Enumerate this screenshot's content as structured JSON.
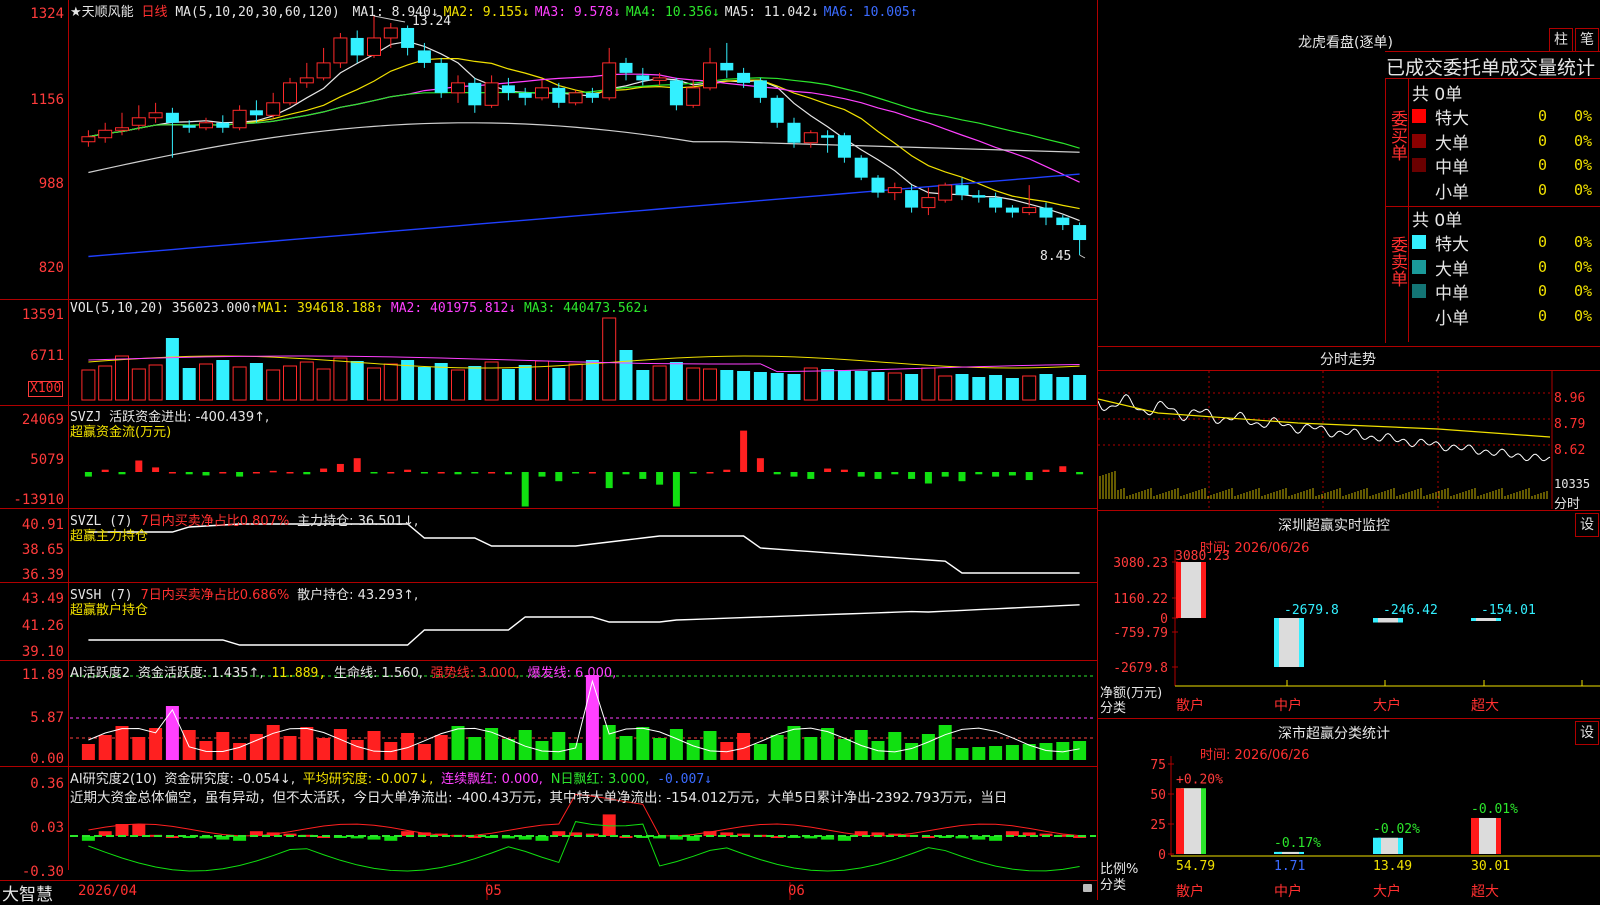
{
  "stock": {
    "name": "★天顺风能",
    "period": "日线",
    "ma_params": "MA(5,10,20,30,60,120)",
    "ma_values": [
      {
        "label": "MA1:",
        "value": "8.940↓",
        "color": "#e6e6e6"
      },
      {
        "label": "MA2:",
        "value": "9.155↓",
        "color": "#f0e000"
      },
      {
        "label": "MA3:",
        "value": "9.578↓",
        "color": "#ff40ff"
      },
      {
        "label": "MA4:",
        "value": "10.356↓",
        "color": "#2ce62c"
      },
      {
        "label": "MA5:",
        "value": "11.042↓",
        "color": "#e6e6e6"
      },
      {
        "label": "MA6:",
        "value": "10.005↑",
        "color": "#3b6bff"
      }
    ],
    "price_axis": [
      "1324",
      "1156",
      "988",
      "820"
    ],
    "high_marker": "13.24",
    "low_marker": "8.45"
  },
  "vol": {
    "legend_name": "VOL(5,10,20)",
    "legend_value": "356023.000↑",
    "ma1": "MA1: 394618.188↑",
    "ma2": "MA2: 401975.812↓",
    "ma3": "MA3: 440473.562↓",
    "axis": [
      "13591",
      "6711"
    ],
    "unit": "X100"
  },
  "svzj": {
    "legend_name": "SVZJ",
    "legend_text": "活跃资金进出: -400.439↑,",
    "subtitle": "超赢资金流(万元)",
    "axis": [
      "24069",
      "5079",
      "-13910"
    ]
  },
  "svzl": {
    "legend_name": "SVZL (7)",
    "legend_text1": "7日内买卖净占比0.807%",
    "legend_text2": "主力持仓: 36.501↓,",
    "subtitle": "超赢主力持仓",
    "axis": [
      "40.91",
      "38.65",
      "36.39"
    ]
  },
  "svsh": {
    "legend_name": "SVSH (7)",
    "legend_text1": "7日内买卖净占比0.686%",
    "legend_text2": "散户持仓: 43.293↑,",
    "subtitle": "超赢散户持仓",
    "axis": [
      "43.49",
      "41.26",
      "39.10"
    ]
  },
  "ai1": {
    "legend_name": "AI活跃度2",
    "legend_text1": "资金活跃度: 1.435↑,",
    "legend_text2": "11.889,",
    "legend_text3": "生命线: 1.560,",
    "legend_text4": "强势线: 3.000,",
    "legend_text5": "爆发线: 6.000,",
    "axis": [
      "11.89",
      "5.87",
      "0.00"
    ]
  },
  "ai2": {
    "legend_name": "AI研究度2(10)",
    "legend_text1": "资金研究度: -0.054↓,",
    "legend_text2": "平均研究度: -0.007↓,",
    "legend_text3": "连续飘红: 0.000,",
    "legend_text4": "N日飘红: 3.000,",
    "legend_text5": "-0.007↓",
    "comment": "近期大资金总体偏空，虽有异动，但不太活跃，今日大单净流出: -400.43万元，其中特大单净流出: -154.012万元，大单5日累计净出-2392.793万元，当日",
    "axis": [
      "0.36",
      "0.03",
      "-0.30"
    ]
  },
  "dates": {
    "d1": "2026/04",
    "d2": "05",
    "d3": "06"
  },
  "brand": "大智慧",
  "right": {
    "lhb_title": "龙虎看盘(逐单)",
    "btn_zhu": "柱",
    "btn_bi": "笔",
    "tabs": "已成交委托单成交量统计",
    "buy_label": "委买单",
    "sell_label": "委卖单",
    "buy_total": "共 0单",
    "sell_total": "共 0单",
    "buy_rows": [
      {
        "name": "特大",
        "count": "0",
        "pct": "0%",
        "color": "#ff0000"
      },
      {
        "name": "大单",
        "count": "0",
        "pct": "0%",
        "color": "#8b0000"
      },
      {
        "name": "中单",
        "count": "0",
        "pct": "0%",
        "color": "#6a0000"
      },
      {
        "name": "小单",
        "count": "0",
        "pct": "0%",
        "color": "#000000"
      }
    ],
    "sell_rows": [
      {
        "name": "特大",
        "count": "0",
        "pct": "0%",
        "color": "#33f0ff"
      },
      {
        "name": "大单",
        "count": "0",
        "pct": "0%",
        "color": "#1a9a9a"
      },
      {
        "name": "中单",
        "count": "0",
        "pct": "0%",
        "color": "#137575"
      },
      {
        "name": "小单",
        "count": "0",
        "pct": "0%",
        "color": "#000000"
      }
    ],
    "fenshi_title": "分时走势",
    "fenshi_axis": [
      "8.96",
      "8.79",
      "8.62"
    ],
    "fenshi_vol": "10335",
    "fenshi_label": "分时",
    "sz_title": "深圳超赢实时监控",
    "sz_btn": "设",
    "sz_time": "时间: 2026/06/26",
    "sz_axis": [
      "3080.23",
      "1160.22",
      "0",
      "-759.79",
      "-2679.8"
    ],
    "sz_ylabel1": "净额(万元)",
    "sz_ylabel2": "分类",
    "sz_bars": [
      {
        "cat": "散户",
        "value": 3080.23,
        "label": "3080.23"
      },
      {
        "cat": "中户",
        "value": -2679.8,
        "label": "-2679.8"
      },
      {
        "cat": "大户",
        "value": -246.42,
        "label": "-246.42"
      },
      {
        "cat": "超大",
        "value": -154.01,
        "label": "-154.01"
      }
    ],
    "cls_title": "深市超赢分类统计",
    "cls_btn": "设",
    "cls_time": "时间: 2026/06/26",
    "cls_axis": [
      "75",
      "50",
      "25",
      "0"
    ],
    "cls_ylabel1": "比例%",
    "cls_ylabel2": "分类",
    "cls_bars": [
      {
        "cat": "散户",
        "value": 54.79,
        "label": "54.79",
        "chg": "+0.20%"
      },
      {
        "cat": "中户",
        "value": 1.71,
        "label": "1.71",
        "chg": "-0.17%"
      },
      {
        "cat": "大户",
        "value": 13.49,
        "label": "13.49",
        "chg": "-0.02%"
      },
      {
        "cat": "超大",
        "value": 30.01,
        "label": "30.01",
        "chg": "-0.01%"
      }
    ]
  },
  "chart_data": [
    {
      "type": "candlestick",
      "title": "天顺风能 日线",
      "ylim": [
        8.2,
        13.24
      ],
      "note": "per-bar [open, close, low, high] for 60 trading days",
      "candles": [
        [
          10.72,
          10.82,
          10.62,
          10.95
        ],
        [
          10.8,
          10.95,
          10.7,
          11.1
        ],
        [
          10.95,
          11.0,
          10.85,
          11.3
        ],
        [
          11.05,
          11.2,
          10.95,
          11.45
        ],
        [
          11.2,
          11.3,
          11.1,
          11.5
        ],
        [
          11.3,
          11.1,
          10.4,
          11.4
        ],
        [
          11.05,
          11.0,
          10.9,
          11.15
        ],
        [
          11.0,
          11.1,
          10.95,
          11.2
        ],
        [
          11.1,
          11.0,
          10.9,
          11.25
        ],
        [
          11.0,
          11.35,
          10.95,
          11.45
        ],
        [
          11.35,
          11.25,
          11.1,
          11.55
        ],
        [
          11.25,
          11.5,
          11.2,
          11.7
        ],
        [
          11.5,
          11.9,
          11.45,
          12.0
        ],
        [
          11.9,
          12.0,
          11.8,
          12.3
        ],
        [
          12.0,
          12.3,
          11.95,
          12.6
        ],
        [
          12.3,
          12.8,
          12.2,
          12.9
        ],
        [
          12.8,
          12.45,
          12.3,
          12.95
        ],
        [
          12.45,
          12.8,
          12.4,
          13.24
        ],
        [
          12.8,
          13.0,
          12.6,
          13.1
        ],
        [
          13.0,
          12.6,
          12.45,
          13.05
        ],
        [
          12.55,
          12.3,
          12.2,
          12.7
        ],
        [
          12.3,
          11.7,
          11.6,
          12.4
        ],
        [
          11.7,
          11.9,
          11.5,
          12.05
        ],
        [
          11.9,
          11.45,
          11.3,
          12.0
        ],
        [
          11.45,
          11.9,
          11.4,
          12.05
        ],
        [
          11.85,
          11.7,
          11.55,
          12.0
        ],
        [
          11.7,
          11.6,
          11.45,
          11.8
        ],
        [
          11.6,
          11.8,
          11.55,
          11.95
        ],
        [
          11.8,
          11.5,
          11.4,
          11.9
        ],
        [
          11.5,
          11.7,
          11.45,
          11.75
        ],
        [
          11.7,
          11.6,
          11.5,
          11.8
        ],
        [
          11.6,
          12.3,
          11.55,
          12.6
        ],
        [
          12.3,
          12.1,
          11.95,
          12.4
        ],
        [
          12.05,
          11.95,
          11.85,
          12.2
        ],
        [
          11.95,
          12.0,
          11.85,
          12.1
        ],
        [
          11.95,
          11.45,
          11.35,
          12.0
        ],
        [
          11.45,
          11.8,
          11.4,
          11.95
        ],
        [
          11.8,
          12.3,
          11.75,
          12.6
        ],
        [
          12.3,
          12.15,
          12.0,
          12.7
        ],
        [
          12.1,
          11.9,
          11.8,
          12.2
        ],
        [
          11.95,
          11.6,
          11.5,
          12.0
        ],
        [
          11.6,
          11.1,
          11.0,
          11.65
        ],
        [
          11.1,
          10.7,
          10.6,
          11.2
        ],
        [
          10.7,
          10.9,
          10.6,
          10.95
        ],
        [
          10.85,
          10.8,
          10.5,
          10.95
        ],
        [
          10.85,
          10.4,
          10.3,
          10.9
        ],
        [
          10.4,
          10.0,
          9.95,
          10.45
        ],
        [
          10.0,
          9.7,
          9.6,
          10.05
        ],
        [
          9.7,
          9.8,
          9.55,
          9.9
        ],
        [
          9.75,
          9.4,
          9.3,
          9.85
        ],
        [
          9.4,
          9.6,
          9.25,
          9.8
        ],
        [
          9.55,
          9.85,
          9.5,
          9.9
        ],
        [
          9.85,
          9.65,
          9.55,
          10.0
        ],
        [
          9.65,
          9.6,
          9.5,
          9.75
        ],
        [
          9.6,
          9.4,
          9.3,
          9.7
        ],
        [
          9.4,
          9.3,
          9.2,
          9.45
        ],
        [
          9.3,
          9.4,
          9.25,
          9.85
        ],
        [
          9.4,
          9.2,
          9.05,
          9.5
        ],
        [
          9.2,
          9.05,
          8.95,
          9.25
        ],
        [
          9.05,
          8.75,
          8.45,
          9.1
        ]
      ]
    }
  ]
}
